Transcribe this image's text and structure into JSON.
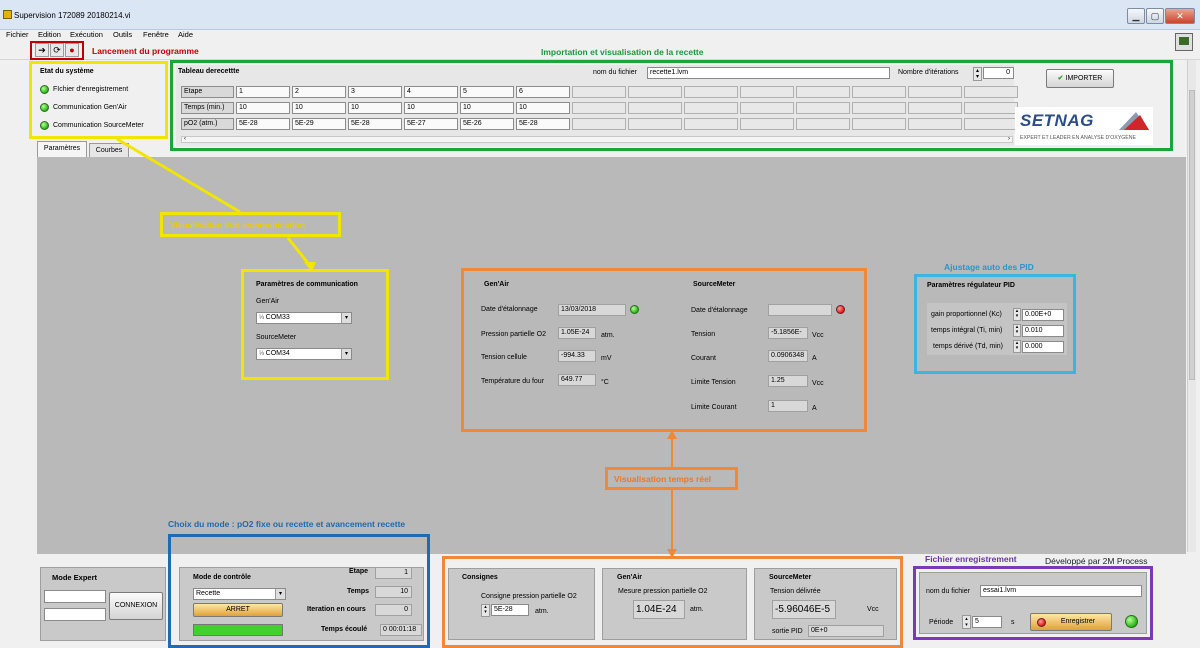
{
  "window": {
    "title": "Supervision 172089 20180214.vi"
  },
  "menu": [
    "Fichier",
    "Edition",
    "Exécution",
    "Outils",
    "Fenêtre",
    "Aide"
  ],
  "annotations": {
    "launch": "Lancement du programme",
    "recipe": "Importation et visualisation de la recette",
    "comm_state": "Visualisation état communication",
    "pid_auto": "Ajustage auto des PID",
    "mode_choice": "Choix du mode : pO2 fixe ou recette et avancement recette",
    "realtime": "Visualisation temps réel",
    "recording": "Fichier enregistrement",
    "developer": "Développé par 2M Process"
  },
  "system_state": {
    "title": "Etat du système",
    "items": [
      {
        "label": "FIchier d'enregistrement"
      },
      {
        "label": "Communication Gen'Air"
      },
      {
        "label": "Communication SourceMeter"
      }
    ]
  },
  "recipe_table": {
    "title": "Tableau derecettte",
    "file_label": "nom du fichier",
    "file_value": "recette1.lvm",
    "iterations_label": "Nombre d'itérations",
    "iterations_value": "0",
    "import_label": "IMPORTER",
    "rows": [
      {
        "header": "Etape",
        "values": [
          "1",
          "2",
          "3",
          "4",
          "5",
          "6"
        ]
      },
      {
        "header": "Temps (min.)",
        "values": [
          "10",
          "10",
          "10",
          "10",
          "10",
          "10"
        ]
      },
      {
        "header": "pO2 (atm.)",
        "values": [
          "5E-28",
          "5E-29",
          "5E-28",
          "5E-27",
          "5E-26",
          "5E-28"
        ]
      }
    ]
  },
  "logo": {
    "name": "SETNAG",
    "tagline": "EXPERT ET LEADER EN ANALYSE D'OXYGÈNE"
  },
  "tabs": [
    {
      "label": "Paramètres"
    },
    {
      "label": "Courbes"
    }
  ],
  "comm_params": {
    "title": "Paramètres de communication",
    "genair_label": "Gen'Air",
    "genair_value": "COM33",
    "sourcemeter_label": "SourceMeter",
    "sourcemeter_value": "COM34"
  },
  "genair": {
    "title": "Gen'Air",
    "calib_label": "Date d'étalonnage",
    "calib_value": "13/03/2018",
    "po2_label": "Pression partielle O2",
    "po2_value": "1.05E-24",
    "po2_unit": "atm.",
    "cell_label": "Tension cellule",
    "cell_value": "-994.33",
    "cell_unit": "mV",
    "temp_label": "Température du four",
    "temp_value": "649.77",
    "temp_unit": "°C"
  },
  "sourcemeter": {
    "title": "SourceMeter",
    "calib_label": "Date d'étalonnage",
    "calib_value": "",
    "tension_label": "Tension",
    "tension_value": "-5.1856E-",
    "tension_unit": "Vcc",
    "courant_label": "Courant",
    "courant_value": "0.0906348",
    "courant_unit": "A",
    "lim_tension_label": "Limite Tension",
    "lim_tension_value": "1.25",
    "lim_tension_unit": "Vcc",
    "lim_courant_label": "Limite Courant",
    "lim_courant_value": "1",
    "lim_courant_unit": "A"
  },
  "pid": {
    "title": "Paramètres régulateur PID",
    "kc_label": "gain proportionnel (Kc)",
    "kc_value": "0.00E+0",
    "ti_label": "temps intégral (Ti, min)",
    "ti_value": "0.010",
    "td_label": "temps dérivé (Td, min)",
    "td_value": "0.000"
  },
  "expert": {
    "title": "Mode Expert",
    "button": "CONNEXION"
  },
  "control": {
    "title": "Mode de contrôle",
    "mode_value": "Recette",
    "stop_label": "ARRET",
    "progress": 1.0,
    "etape_label": "Etape",
    "etape_value": "1",
    "temps_label": "Temps",
    "temps_value": "10",
    "iter_label": "Iteration en cours",
    "iter_value": "0",
    "elapsed_label": "Temps écoulé",
    "elapsed_value": "0  00:01:18"
  },
  "consignes": {
    "title": "Consignes",
    "po2_label": "Consigne pression partielle O2",
    "po2_value": "5E-28",
    "po2_unit": "atm."
  },
  "genair_meas": {
    "title": "Gen'Air",
    "label": "Mesure pression partielle O2",
    "value": "1.04E-24",
    "unit": "atm."
  },
  "sm_meas": {
    "title": "SourceMeter",
    "label": "Tension délivrée",
    "value": "-5.96046E-5",
    "unit": "Vcc",
    "pid_label": "sortie PID",
    "pid_value": "0E+0"
  },
  "recording": {
    "file_label": "nom du fichier",
    "file_value": "essai1.lvm",
    "period_label": "Période",
    "period_value": "5",
    "period_unit": "s",
    "button": "Enregistrer"
  }
}
